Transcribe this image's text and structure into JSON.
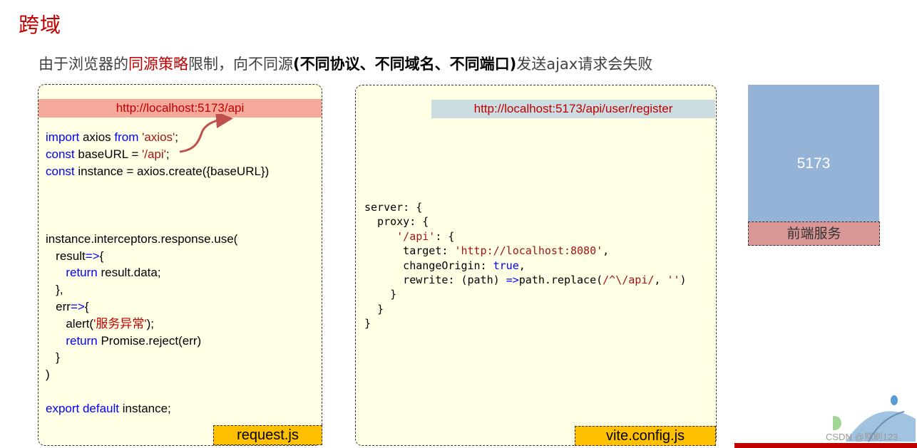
{
  "title": "跨域",
  "subtitle": {
    "part1": "由于浏览器的",
    "highlight": "同源策略",
    "part2": "限制，向不同源",
    "bold": "(不同协议、不同域名、不同端口)",
    "part3": "发送ajax请求会失败"
  },
  "left_panel": {
    "url": "http://localhost:5173/api",
    "file_label": "request.js",
    "code": {
      "l1_kw1": "import",
      "l1_t1": " axios ",
      "l1_kw2": "from",
      "l1_t2": " ",
      "l1_str": "'axios'",
      "l1_t3": ";",
      "l2_kw": "const",
      "l2_t1": " baseURL = ",
      "l2_str": "'/api'",
      "l2_t2": ";",
      "l3_kw": "const",
      "l3_t1": " instance = axios.create({baseURL})",
      "l4": "instance.interceptors.response.use(",
      "l5_t1": "   result",
      "l5_kw": "=>",
      "l5_t2": "{",
      "l6_kw": "      return",
      "l6_t1": " result.data;",
      "l7": "   },",
      "l8_t1": "   err",
      "l8_kw": "=>",
      "l8_t2": "{",
      "l9_t1": "      alert(",
      "l9_str": "'服务异常'",
      "l9_t2": ");",
      "l10_kw": "      return",
      "l10_t1": " Promise.reject(err)",
      "l11": "   }",
      "l12": ")",
      "l13_kw": "export default",
      "l13_t1": " instance;"
    }
  },
  "mid_panel": {
    "url": "http://localhost:5173/api/user/register",
    "file_label": "vite.config.js",
    "code": {
      "l1": "server: {",
      "l2": "  proxy: {",
      "l3_t1": "     ",
      "l3_str": "'/api'",
      "l3_t2": ": {",
      "l4_t1": "      target: ",
      "l4_str": "'http://localhost:8080'",
      "l4_t2": ",",
      "l5_t1": "      changeOrigin: ",
      "l5_kw": "true",
      "l5_t2": ",",
      "l6_t1": "      rewrite: (path) ",
      "l6_kw": "=>",
      "l6_t2": "path.replace(",
      "l6_str": "/^\\/api/",
      "l6_t3": ", ",
      "l6_str2": "''",
      "l6_t4": ")",
      "l7": "    }",
      "l8": "  }",
      "l9": "}"
    }
  },
  "server": {
    "port": "5173",
    "label": "前端服务"
  },
  "watermark": "CSDN @怒刷123",
  "colors": {
    "title_red": "#c00000",
    "panel_bg": "#ffffe6",
    "file_label_bg": "#ffc000",
    "server_blue": "#95b3d7",
    "server_label_bg": "#d99694"
  }
}
